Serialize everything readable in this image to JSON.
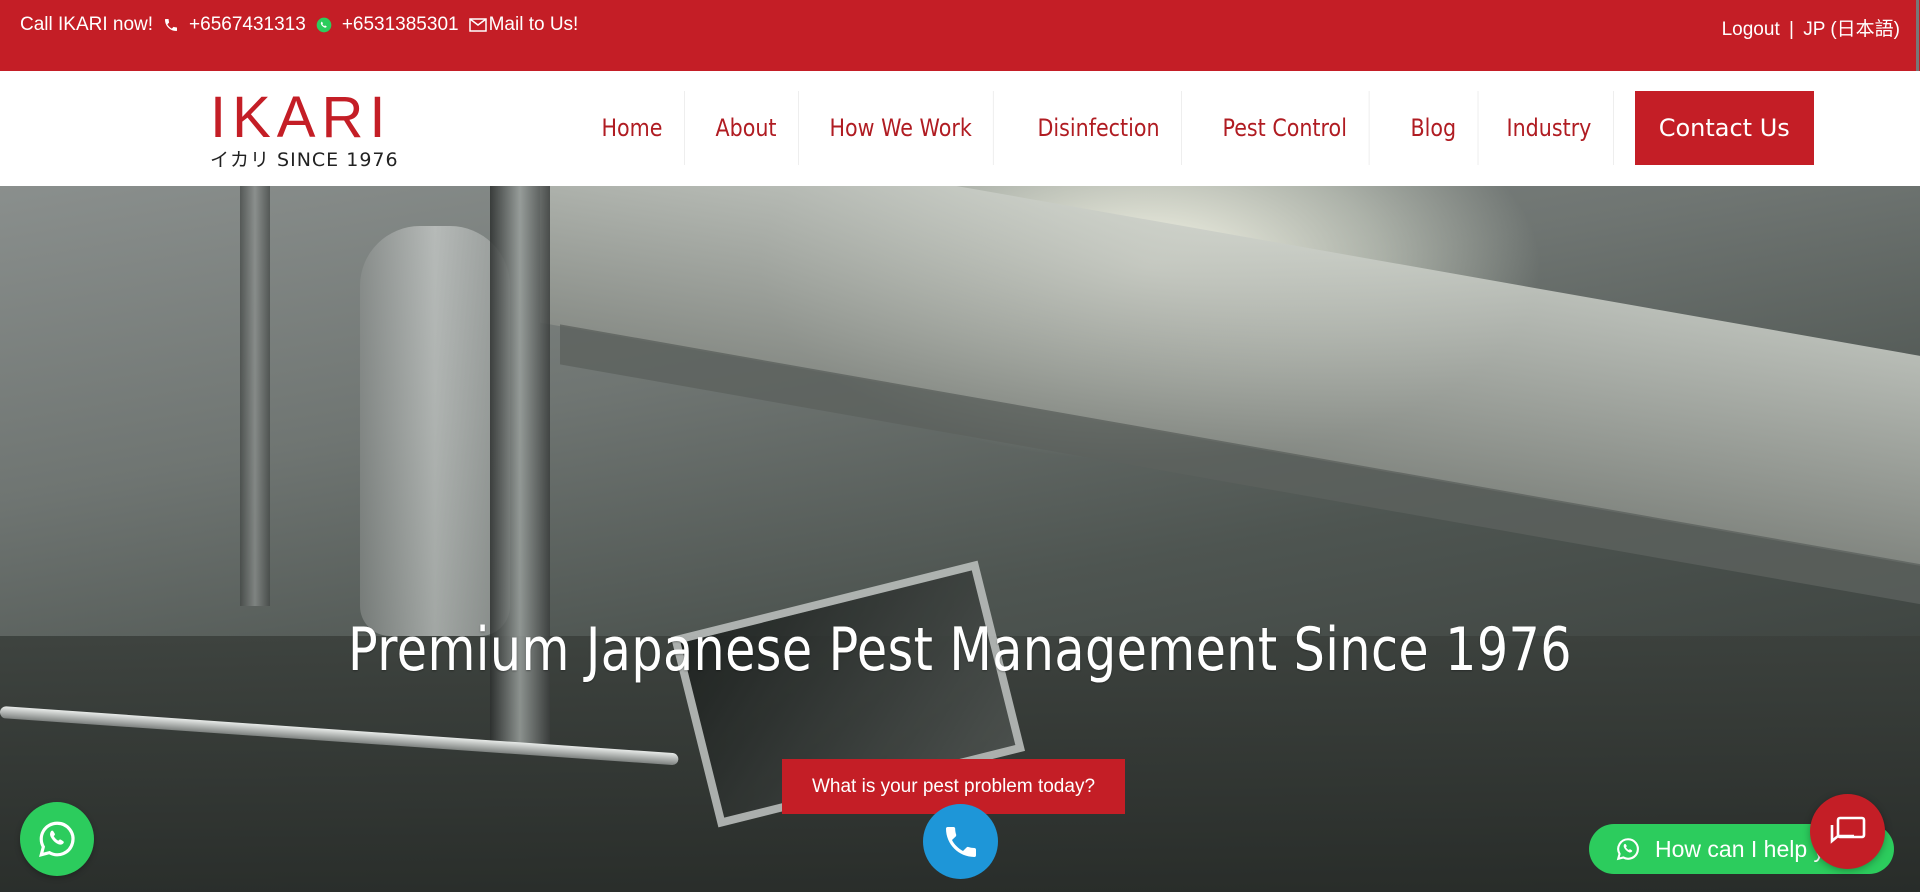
{
  "topbar": {
    "call_label": "Call IKARI now!",
    "phone1": "+6567431313",
    "phone2": "+6531385301",
    "mail_label": "Mail to Us!",
    "logout_label": "Logout",
    "separator": "|",
    "lang_label": "JP (日本語)"
  },
  "logo": {
    "mark": "IKARI",
    "sub": "イカリ SINCE 1976"
  },
  "nav": {
    "items": [
      {
        "label": "Home"
      },
      {
        "label": "About"
      },
      {
        "label": "How We Work"
      },
      {
        "label": "Disinfection"
      },
      {
        "label": "Pest Control"
      },
      {
        "label": "Blog"
      },
      {
        "label": "Industry"
      }
    ],
    "contact_label": "Contact Us"
  },
  "hero": {
    "headline": "Premium Japanese Pest Management Since 1976",
    "cta_label": "What is your pest problem today?"
  },
  "help_label": "How can I help you?",
  "colors": {
    "brand_red": "#c41e26",
    "whatsapp_green": "#2ccc5d",
    "phone_blue": "#1e96d8"
  },
  "icons": [
    "phone-icon",
    "whatsapp-icon",
    "mail-icon",
    "chat-icon"
  ]
}
